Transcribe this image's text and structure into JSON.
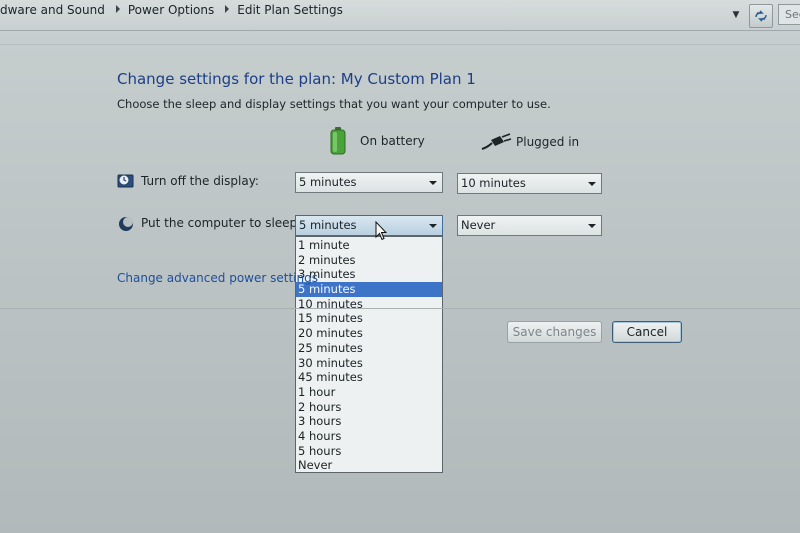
{
  "address_bar": {
    "breadcrumbs": [
      "dware and Sound",
      "Power Options",
      "Edit Plan Settings"
    ],
    "search_placeholder": "Sec"
  },
  "page": {
    "heading": "Change settings for the plan: My Custom Plan 1",
    "subheading": "Choose the sleep and display settings that you want your computer to use."
  },
  "columns": {
    "on_battery": "On battery",
    "plugged_in": "Plugged in"
  },
  "rows": {
    "display": {
      "label": "Turn off the display:",
      "on_battery": "5 minutes",
      "plugged_in": "10 minutes"
    },
    "sleep": {
      "label": "Put the computer to sleep:",
      "on_battery": "5 minutes",
      "plugged_in": "Never"
    }
  },
  "sleep_dropdown": {
    "options": [
      "1 minute",
      "2 minutes",
      "3 minutes",
      "5 minutes",
      "10 minutes",
      "15 minutes",
      "20 minutes",
      "25 minutes",
      "30 minutes",
      "45 minutes",
      "1 hour",
      "2 hours",
      "3 hours",
      "4 hours",
      "5 hours",
      "Never"
    ],
    "selected_index": 3
  },
  "links": {
    "advanced": "Change advanced power settings"
  },
  "buttons": {
    "save": "Save changes",
    "cancel": "Cancel"
  },
  "colors": {
    "heading": "#1e3f87",
    "link": "#1d4f9c",
    "selection": "#3d74c8",
    "battery": "#4aa33a"
  }
}
